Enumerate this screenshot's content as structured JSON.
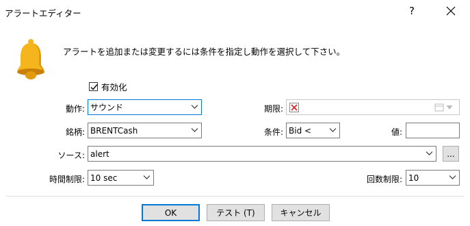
{
  "window": {
    "title": "アラートエディター",
    "help": "?",
    "close": "✕"
  },
  "description": "アラートを追加または変更するには条件を指定し動作を選択して下さい。",
  "enabled": {
    "label": "有効化",
    "checked": true
  },
  "action": {
    "label": "動作:",
    "value": "サウンド"
  },
  "expiry": {
    "label": "期限:",
    "value": ""
  },
  "symbol": {
    "label": "銘柄:",
    "value": "BRENTCash"
  },
  "condition": {
    "label": "条件:",
    "value": "Bid <"
  },
  "value_field": {
    "label": "値:",
    "value": ""
  },
  "source": {
    "label": "ソース:",
    "value": "alert",
    "browse": "..."
  },
  "timeout": {
    "label": "時間制限:",
    "value": "10 sec"
  },
  "max_iterations": {
    "label": "回数制限:",
    "value": "10"
  },
  "buttons": {
    "ok": "OK",
    "test": "テスト (T)",
    "cancel": "キャンセル"
  },
  "colors": {
    "accent": "#0078d7",
    "bell": "#f5b51c",
    "expiry_x": "#d62020"
  }
}
